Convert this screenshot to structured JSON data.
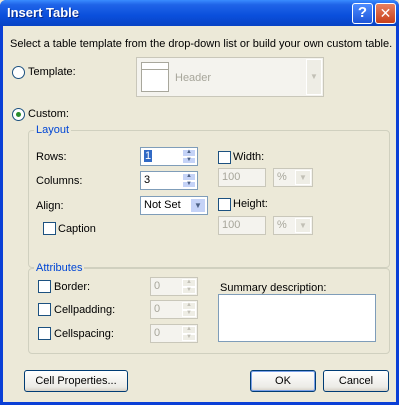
{
  "window": {
    "title": "Insert Table",
    "help_glyph": "?",
    "close_glyph": "✕"
  },
  "instructions": "Select a table template from the drop-down list or build your own custom table.",
  "template": {
    "label": "Template:",
    "value": "Header",
    "selected": false
  },
  "custom": {
    "label": "Custom:",
    "selected": true
  },
  "layout": {
    "legend": "Layout",
    "rows_label": "Rows:",
    "rows_value": "1",
    "columns_label": "Columns:",
    "columns_value": "3",
    "align_label": "Align:",
    "align_value": "Not Set",
    "caption_label": "Caption",
    "width_label": "Width:",
    "width_value": "100",
    "width_unit": "%",
    "height_label": "Height:",
    "height_value": "100",
    "height_unit": "%"
  },
  "attributes": {
    "legend": "Attributes",
    "border_label": "Border:",
    "border_value": "0",
    "cellpadding_label": "Cellpadding:",
    "cellpadding_value": "0",
    "cellspacing_label": "Cellspacing:",
    "cellspacing_value": "0",
    "summary_label": "Summary description:",
    "summary_value": ""
  },
  "buttons": {
    "cell_properties": "Cell Properties...",
    "ok": "OK",
    "cancel": "Cancel"
  },
  "icons": {
    "spin_up": "▲",
    "spin_down": "▼",
    "dropdown": "▼"
  },
  "colors": {
    "title_bar": "#0a4fdc",
    "group_legend": "#0046d5",
    "selection": "#316ac5"
  }
}
